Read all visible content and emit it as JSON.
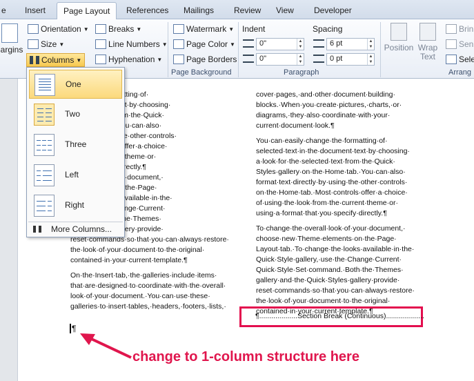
{
  "tabs": [
    "e",
    "Insert",
    "Page Layout",
    "References",
    "Mailings",
    "Review",
    "View",
    "Developer"
  ],
  "ribbon": {
    "margins_label": "argins",
    "orientation": "Orientation",
    "size": "Size",
    "columns": "Columns",
    "breaks": "Breaks",
    "line_numbers": "Line Numbers",
    "hyphenation": "Hyphenation",
    "watermark": "Watermark",
    "page_color": "Page Color",
    "page_borders": "Page Borders",
    "page_background_label": "Page Background",
    "indent_label": "Indent",
    "indent_left": "0\"",
    "indent_right": "0\"",
    "spacing_label": "Spacing",
    "spacing_before": "6 pt",
    "spacing_after": "0 pt",
    "paragraph_label": "Paragraph",
    "position": "Position",
    "wrap_text": "Wrap",
    "wrap_text_2": "Text",
    "bring": "Brin",
    "send": "Sen",
    "select": "Sele",
    "arrange_label": "Arrang"
  },
  "columns_menu": {
    "items": [
      "One",
      "Two",
      "Three",
      "Left",
      "Right"
    ],
    "more": "More Columns..."
  },
  "document": {
    "left_col": [
      "hange·the·formatting·of·",
      "he·document·text·by·choosing·",
      "selected·text·from·the·Quick·",
      "he·Home·tab.·You·can·also·",
      "ectly·by·using·the·other·controls·",
      ".·Most·controls·offer·a·choice·",
      "from·the·current·theme·or·",
      "at·you·specify·directly.¶",
      "erall·look·of·your·document,·",
      "me·elements·on·the·Page·",
      "ange·the·looks·available·in·the·",
      "ery,·use·the·Change·Current·",
      "ommand.·Both·the·Themes·",
      "Quick·Styles·gallery·provide·",
      "reset·commands·so·that·you·can·always·restore·",
      "the·look·of·your·document·to·the·original·",
      "contained·in·your·current·template.¶"
    ],
    "left_para2": [
      "On·the·Insert·tab,·the·galleries·include·items·",
      "that·are·designed·to·coordinate·with·the·overall·",
      "look·of·your·document.·You·can·use·these·",
      "galleries·to·insert·tables,·headers,·footers,·lists,·"
    ],
    "right_para1": [
      "cover·pages,·and·other·document·building·",
      "blocks.·When·you·create·pictures,·charts,·or·",
      "diagrams,·they·also·coordinate·with·your·",
      "current·document·look.¶"
    ],
    "right_para2": [
      "You·can·easily·change·the·formatting·of·",
      "selected·text·in·the·document·text·by·choosing·",
      "a·look·for·the·selected·text·from·the·Quick·",
      "Styles·gallery·on·the·Home·tab.·You·can·also·",
      "format·text·directly·by·using·the·other·controls·",
      "on·the·Home·tab.·Most·controls·offer·a·choice·",
      "of·using·the·look·from·the·current·theme·or·",
      "using·a·format·that·you·specify·directly.¶"
    ],
    "right_para3": [
      "To·change·the·overall·look·of·your·document,·",
      "choose·new·Theme·elements·on·the·Page·",
      "Layout·tab.·To·change·the·looks·available·in·the·",
      "Quick·Style·gallery,·use·the·Change·Current·",
      "Quick·Style·Set·command.·Both·the·Themes·",
      "gallery·and·the·Quick·Styles·gallery·provide·",
      "reset·commands·so·that·you·can·always·restore·",
      "the·look·of·your·document·to·the·original·",
      "contained·in·your·current·template.¶"
    ],
    "section_break": "¶...................Section Break (Continuous)...................",
    "cursor_mark": "¶"
  },
  "annotation": "change to 1-column structure here",
  "colors": {
    "accent": "#e30e4e"
  }
}
